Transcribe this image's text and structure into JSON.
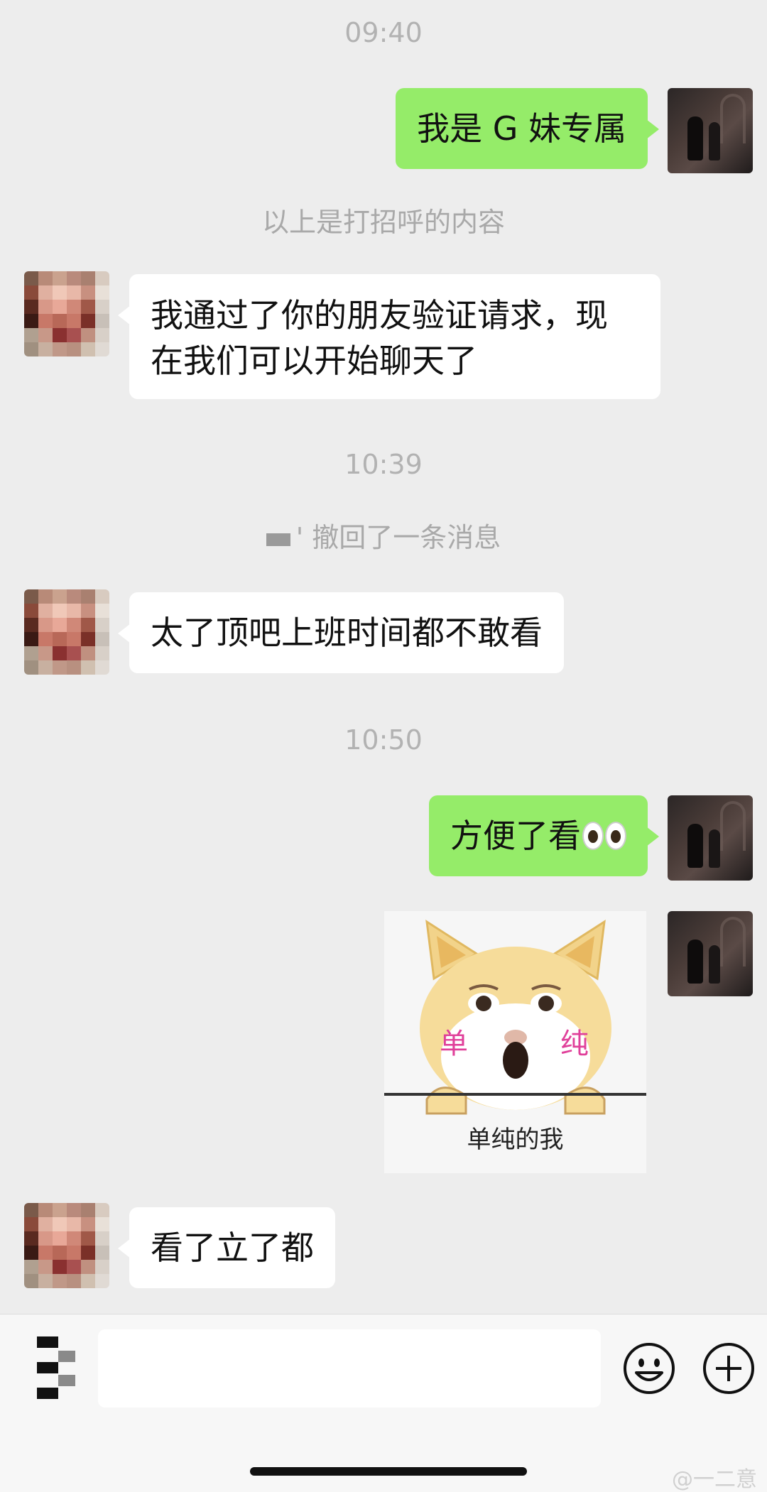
{
  "timestamps": [
    "09:40",
    "10:39",
    "10:50"
  ],
  "messages": {
    "m1": "我是 G 妹专属",
    "sys_greeting": "以上是打招呼的内容",
    "m2_line1": "我通过了你的朋友验证请求，现",
    "m2_line2": "在我们可以开始聊天了",
    "recalled": "' 撤回了一条消息",
    "m3": "太了顶吧上班时间都不敢看",
    "m4": "方便了看",
    "sticker_caption": "单纯的我",
    "sticker_cheek_left": "单",
    "sticker_cheek_right": "纯",
    "m5": "看了立了都"
  },
  "input": {
    "placeholder": ""
  },
  "icons": {
    "voice": "voice-keyboard-icon",
    "emoji": "emoji-icon",
    "plus": "plus-icon",
    "eyes": "eyes-emoji-icon"
  },
  "colors": {
    "self_bubble": "#95ec69",
    "other_bubble": "#ffffff",
    "background": "#ededed"
  },
  "watermark": "@一二意"
}
